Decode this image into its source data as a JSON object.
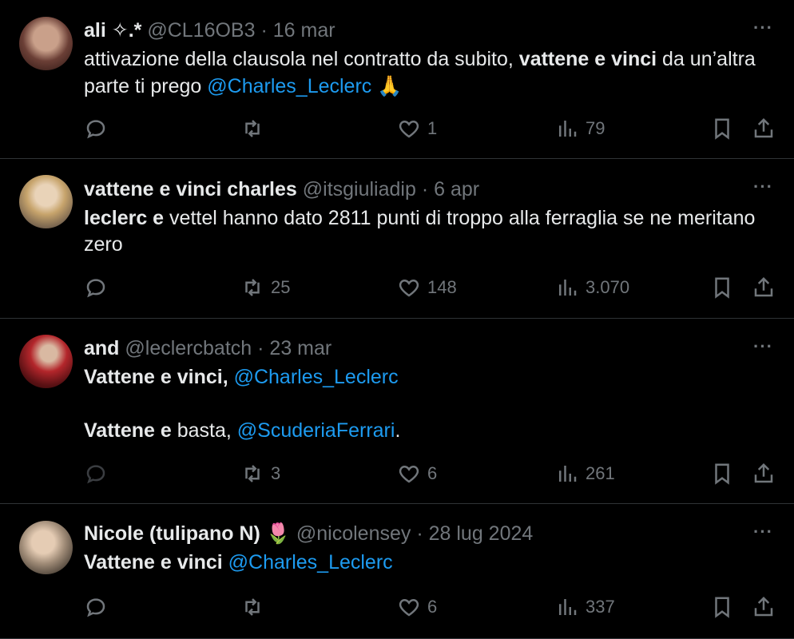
{
  "tweets": [
    {
      "name": "ali ✧.*",
      "handle": "@CL16OB3",
      "sep": "·",
      "date": "16 mar",
      "text_a": "attivazione della clausola nel contratto da subito, ",
      "text_b": "vattene e vinci",
      "text_c": " da un’altra parte ti prego ",
      "mention": "@Charles_Leclerc",
      "emoji": "🙏",
      "replies": "",
      "retweets": "",
      "likes": "1",
      "views": "79"
    },
    {
      "name": "vattene e vinci charles",
      "handle": "@itsgiuliadip",
      "sep": "·",
      "date": "6 apr",
      "text_a": "leclerc e",
      "text_b": " vettel hanno dato 2811 punti di troppo alla ferraglia se ne meritano zero",
      "replies": "",
      "retweets": "25",
      "likes": "148",
      "views": "3.070"
    },
    {
      "name": "and",
      "handle": "@leclercbatch",
      "sep": "·",
      "date": "23 mar",
      "line1_a": "Vattene e vinci, ",
      "line1_mention": "@Charles_Leclerc",
      "line2_a": "Vattene e",
      "line2_b": " basta, ",
      "line2_mention": "@ScuderiaFerrari",
      "line2_end": ".",
      "replies": "",
      "retweets": "3",
      "likes": "6",
      "views": "261"
    },
    {
      "name": "Nicole (tulipano N)",
      "name_emoji": "🌷",
      "handle": "@nicolensey",
      "sep": "·",
      "date": "28 lug 2024",
      "text_a": "Vattene e vinci ",
      "mention": "@Charles_Leclerc",
      "replies": "",
      "retweets": "",
      "likes": "6",
      "views": "337"
    }
  ],
  "more_label": "···",
  "icons": [
    "reply-icon",
    "retweet-icon",
    "like-icon",
    "views-icon",
    "bookmark-icon",
    "share-icon"
  ],
  "colors": {
    "background": "#000000",
    "text": "#e7e9ea",
    "muted": "#71767b",
    "mention": "#1d9bf0",
    "divider": "#2f3336"
  }
}
